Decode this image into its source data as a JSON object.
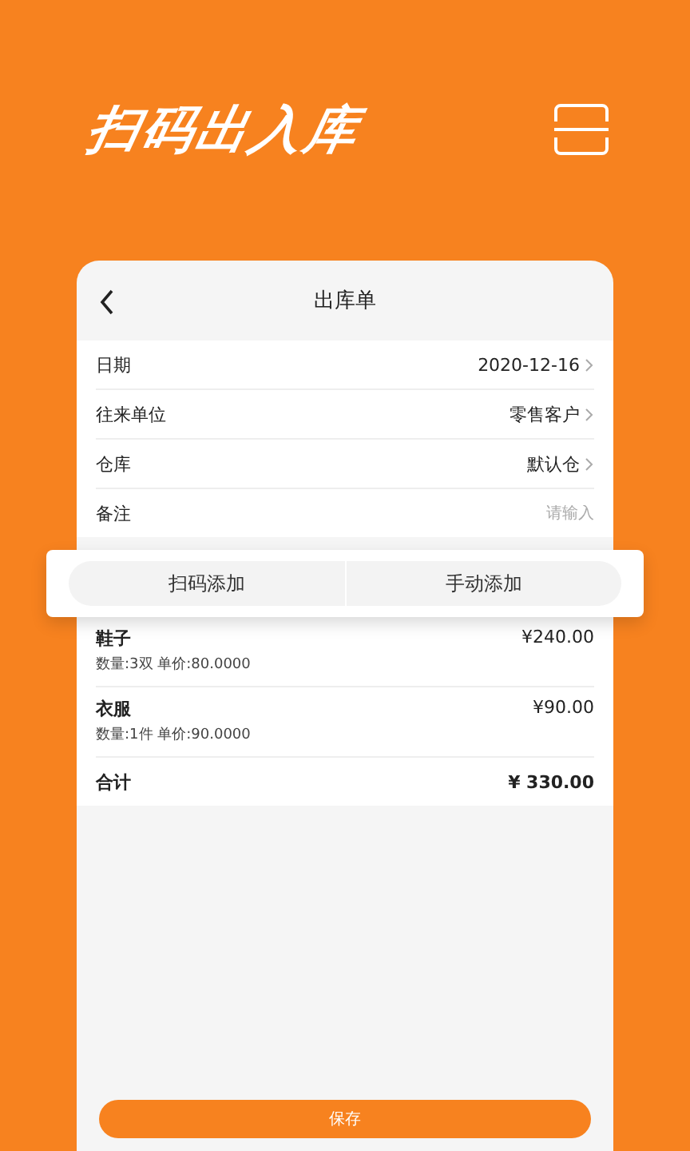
{
  "headline": "扫码出入库",
  "screen": {
    "title": "出库单",
    "fields": [
      {
        "label": "日期",
        "value": "2020-12-16",
        "kind": "select"
      },
      {
        "label": "往来单位",
        "value": "零售客户",
        "kind": "select"
      },
      {
        "label": "仓库",
        "value": "默认仓",
        "kind": "select"
      },
      {
        "label": "备注",
        "placeholder": "请输入",
        "kind": "input"
      }
    ],
    "add_tabs": [
      {
        "label": "扫码添加"
      },
      {
        "label": "手动添加"
      }
    ],
    "items": [
      {
        "name": "鞋子",
        "detail": "数量:3双 单价:80.0000",
        "amount": "¥240.00"
      },
      {
        "name": "衣服",
        "detail": "数量:1件 单价:90.0000",
        "amount": "¥90.00"
      }
    ],
    "total": {
      "label": "合计",
      "amount": "¥ 330.00"
    },
    "save_button": "保存"
  }
}
